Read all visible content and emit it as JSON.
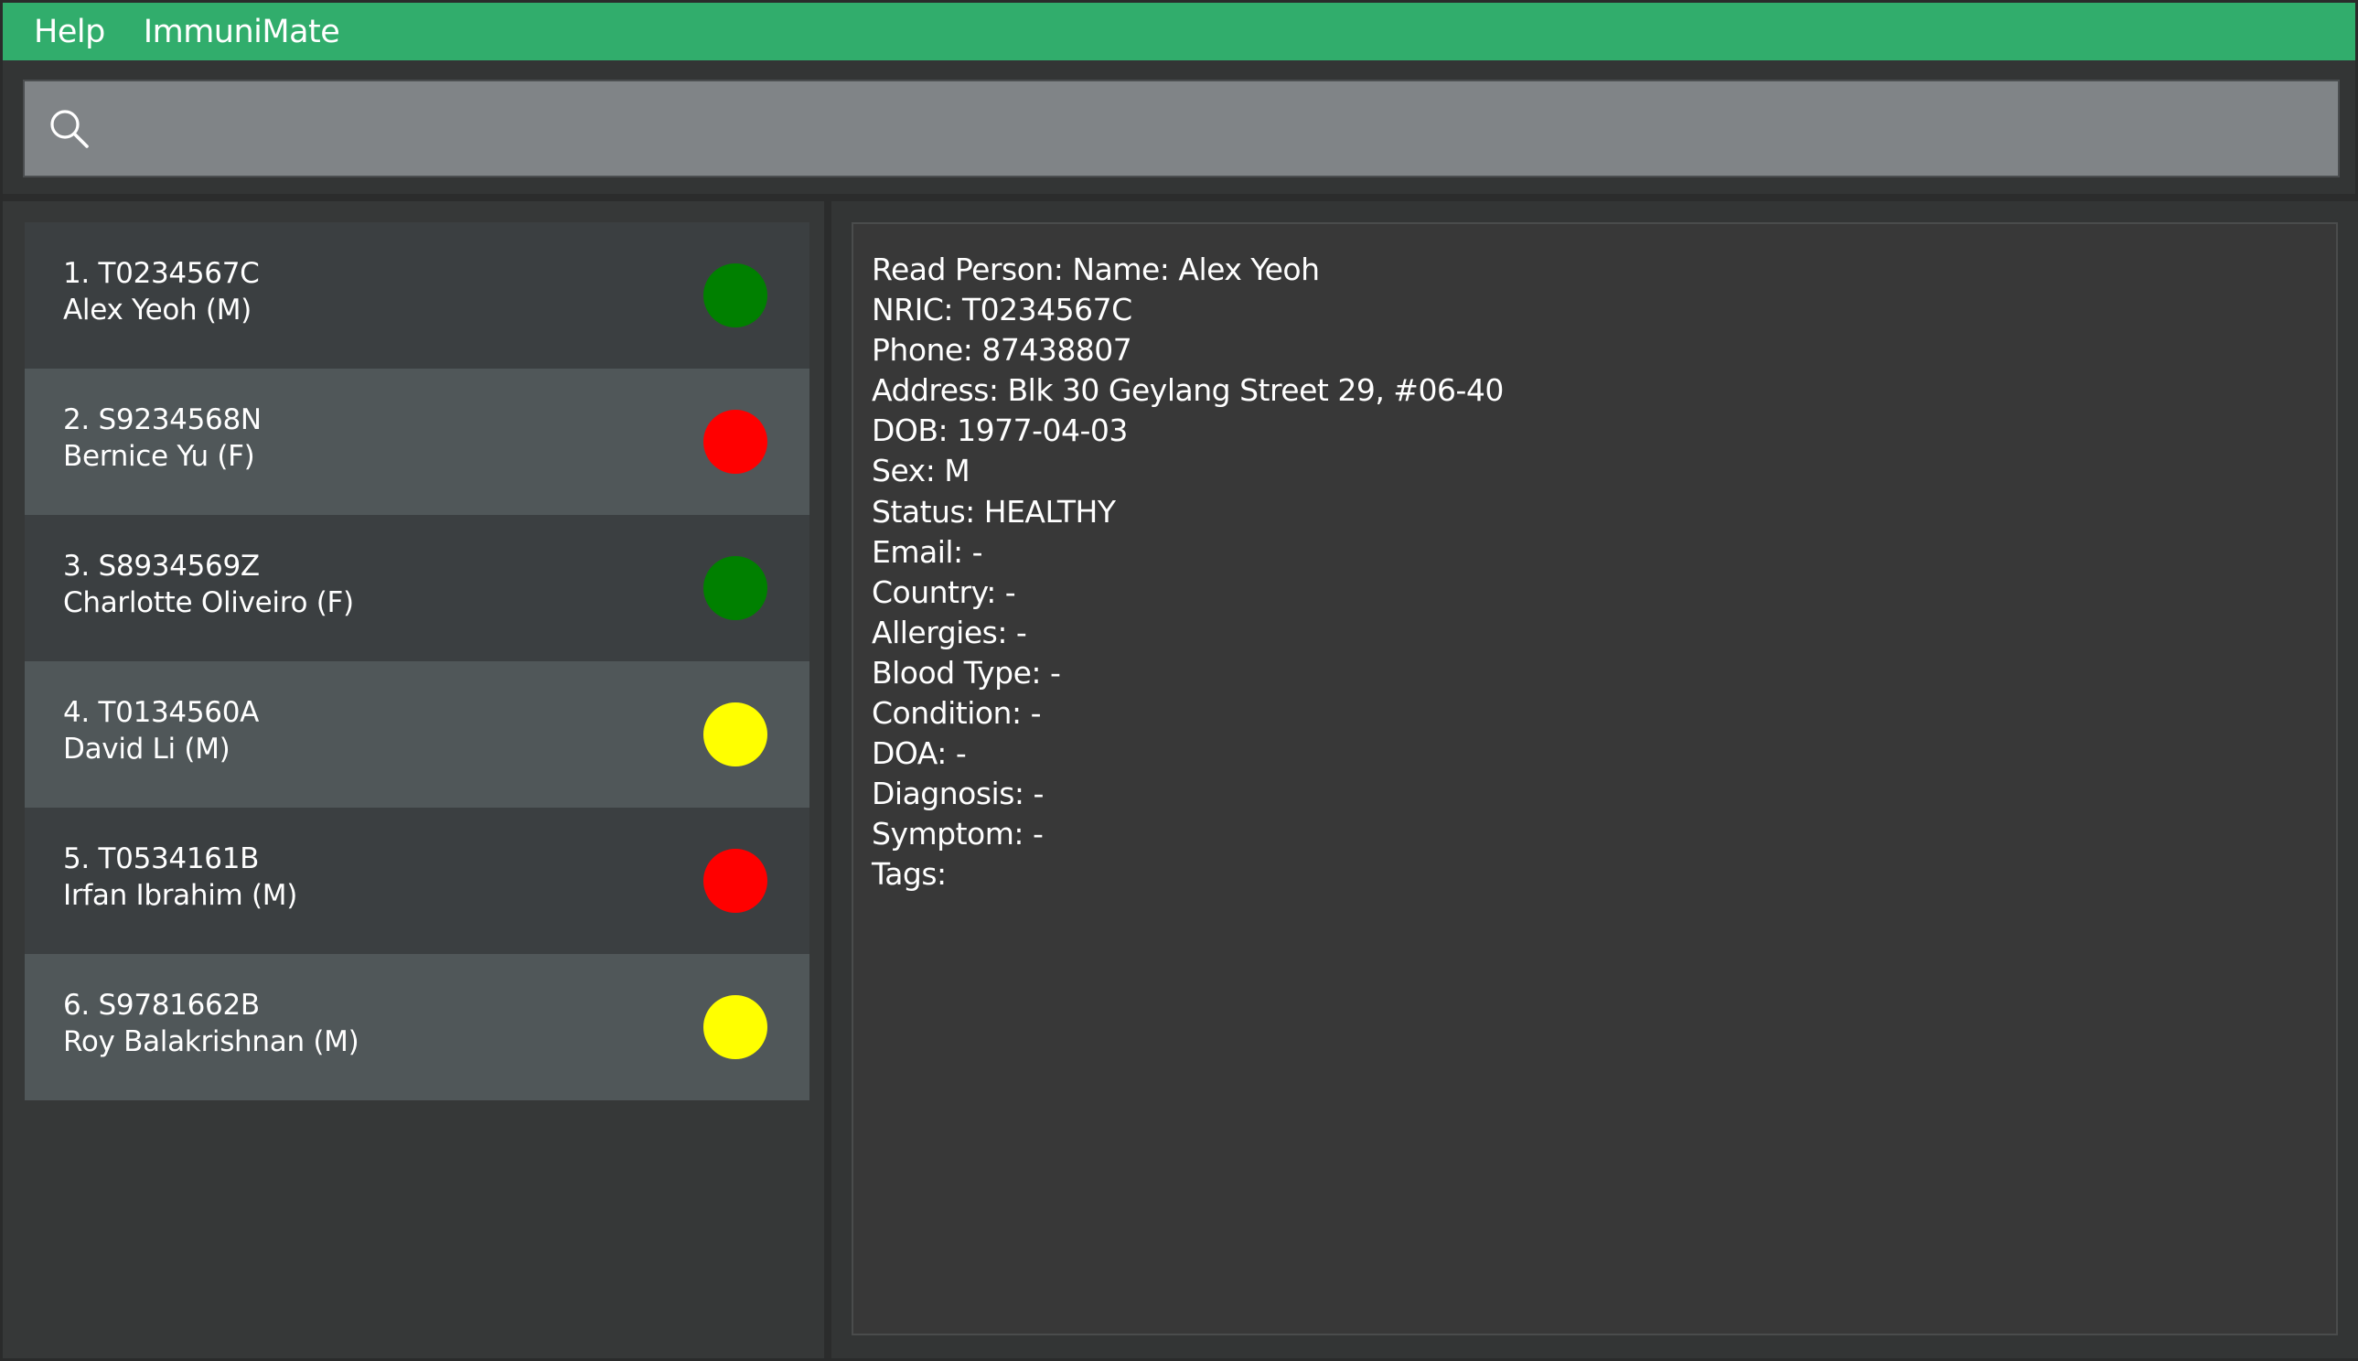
{
  "menu": {
    "help_label": "Help",
    "app_label": "ImmuniMate"
  },
  "search": {
    "value": "",
    "placeholder": "",
    "icon": "search-icon"
  },
  "persons": [
    {
      "index_nric": "1. T0234567C",
      "name_sex": "Alex Yeoh (M)",
      "status_color": "#008000"
    },
    {
      "index_nric": "2. S9234568N",
      "name_sex": "Bernice Yu (F)",
      "status_color": "#ff0000"
    },
    {
      "index_nric": "3. S8934569Z",
      "name_sex": "Charlotte Oliveiro (F)",
      "status_color": "#008000"
    },
    {
      "index_nric": "4. T0134560A",
      "name_sex": "David Li (M)",
      "status_color": "#ffff00"
    },
    {
      "index_nric": "5. T0534161B",
      "name_sex": "Irfan Ibrahim (M)",
      "status_color": "#ff0000"
    },
    {
      "index_nric": "6. S9781662B",
      "name_sex": "Roy Balakrishnan (M)",
      "status_color": "#ffff00"
    }
  ],
  "detail": {
    "lines": [
      "Read Person: Name: Alex Yeoh",
      "NRIC: T0234567C",
      "Phone: 87438807",
      "Address: Blk 30 Geylang Street 29, #06-40",
      "DOB: 1977-04-03",
      "Sex: M",
      "Status: HEALTHY",
      "Email: -",
      "Country: -",
      "Allergies: -",
      "Blood Type: -",
      "Condition: -",
      "DOA: -",
      "Diagnosis: -",
      "Symptom: -",
      "Tags:"
    ]
  },
  "colors": {
    "menubar": "#31ad6c",
    "search_bg": "#808487",
    "card_dark": "#3b3f41",
    "card_light": "#505759",
    "healthy": "#008000",
    "unwell": "#ffff00",
    "infected": "#ff0000"
  }
}
